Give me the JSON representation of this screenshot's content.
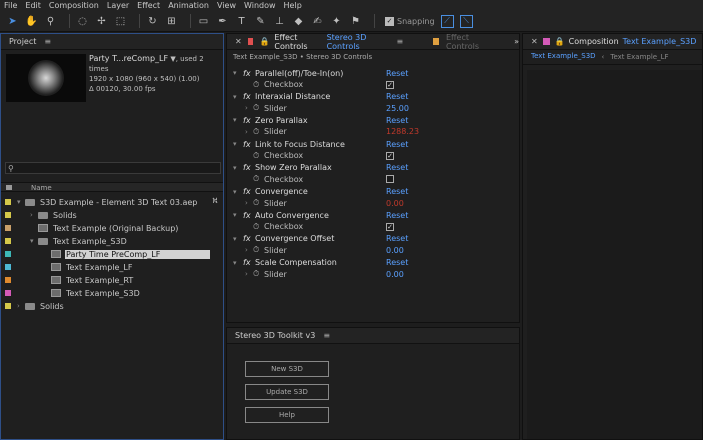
{
  "menu": [
    "File",
    "Edit",
    "Composition",
    "Layer",
    "Effect",
    "Animation",
    "View",
    "Window",
    "Help"
  ],
  "toolbar": {
    "snapping_label": "Snapping",
    "snapping_checked": true
  },
  "project": {
    "tab_label": "Project",
    "item_name": "Party T...reComp_LF",
    "used_text": ", used 2 times",
    "dims": "1920 x 1080  (960 x 540) (1.00)",
    "duration": "Δ 00120, 30.00 fps",
    "search_glyph": "⚲",
    "col_name": "Name",
    "tree": [
      {
        "label": "S3D Example - Element 3D Text 03.aep",
        "type": "folder",
        "indent": 0,
        "color": "#d4c84a",
        "expanded": true
      },
      {
        "label": "Solids",
        "type": "folder",
        "indent": 1,
        "color": "#d4c84a",
        "expanded": false
      },
      {
        "label": "Text Example (Original Backup)",
        "type": "comp",
        "indent": 1,
        "color": "#c9a06a"
      },
      {
        "label": "Text Example_S3D",
        "type": "folder",
        "indent": 1,
        "color": "#d4c84a",
        "expanded": true
      },
      {
        "label": "Party Time PreComp_LF",
        "type": "comp",
        "indent": 2,
        "color": "#3db8b8",
        "selected": true
      },
      {
        "label": "Text Example_LF",
        "type": "comp",
        "indent": 2,
        "color": "#4db8d4"
      },
      {
        "label": "Text Example_RT",
        "type": "comp",
        "indent": 2,
        "color": "#e08a2e"
      },
      {
        "label": "Text Example_S3D",
        "type": "comp",
        "indent": 2,
        "color": "#d45ab8"
      },
      {
        "label": "Solids",
        "type": "folder",
        "indent": 0,
        "color": "#d4c84a",
        "expanded": false
      }
    ]
  },
  "effects": {
    "tab_label": "Effect Controls",
    "tab_target": "Stereo 3D Controls",
    "other_tab": "Effect Controls",
    "breadcrumb": "Text Example_S3D • Stereo 3D Controls",
    "reset_label": "Reset",
    "items": [
      {
        "name": "Parallel(off)/Toe-In(on)",
        "param": "Checkbox",
        "kind": "checkbox",
        "checked": true
      },
      {
        "name": "Interaxial Distance",
        "param": "Slider",
        "kind": "slider",
        "value": "25.00"
      },
      {
        "name": "Zero Parallax",
        "param": "Slider",
        "kind": "slider",
        "value": "1288.23",
        "red": true
      },
      {
        "name": "Link to Focus Distance",
        "param": "Checkbox",
        "kind": "checkbox",
        "checked": true
      },
      {
        "name": "Show Zero Parallax",
        "param": "Checkbox",
        "kind": "checkbox",
        "checked": false
      },
      {
        "name": "Convergence",
        "param": "Slider",
        "kind": "slider",
        "value": "0.00",
        "red": true
      },
      {
        "name": "Auto Convergence",
        "param": "Checkbox",
        "kind": "checkbox",
        "checked": true
      },
      {
        "name": "Convergence Offset",
        "param": "Slider",
        "kind": "slider",
        "value": "0.00"
      },
      {
        "name": "Scale Compensation",
        "param": "Slider",
        "kind": "slider",
        "value": "0.00"
      }
    ]
  },
  "toolkit": {
    "title": "Stereo 3D Toolkit v3",
    "buttons": [
      "New S3D",
      "Update S3D",
      "Help"
    ]
  },
  "composition": {
    "tab_label": "Composition",
    "tab_target": "Text Example_S3D",
    "sub_tabs": [
      "Text Example_S3D",
      "Text Example_LF"
    ]
  },
  "colors": {
    "accent": "#5aa0ff",
    "tab_red": "#e05050",
    "tab_orange": "#e0a040",
    "tab_pink": "#d45ab8"
  }
}
